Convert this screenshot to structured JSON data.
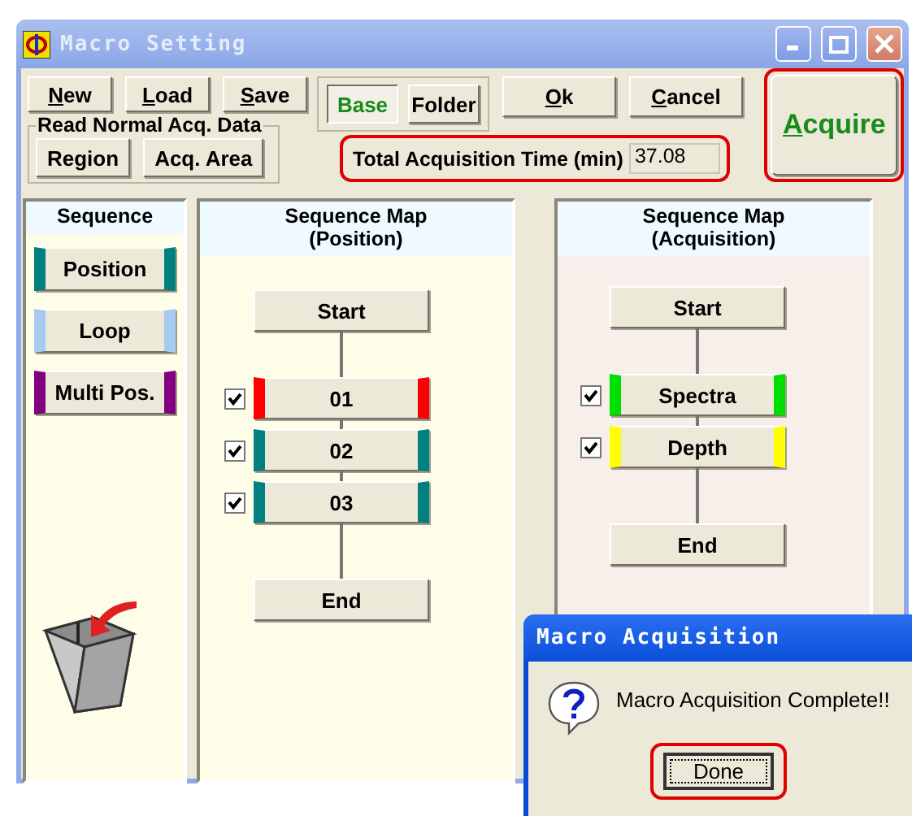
{
  "window": {
    "title": "Macro Setting"
  },
  "file_buttons": [
    {
      "key": "N",
      "rest": "ew"
    },
    {
      "key": "L",
      "rest": "oad"
    },
    {
      "key": "S",
      "rest": "ave"
    }
  ],
  "view_toggle": [
    {
      "label": "Base",
      "selected": true
    },
    {
      "label": "Folder",
      "selected": false
    }
  ],
  "ok_button": {
    "key": "O",
    "rest": "k"
  },
  "cancel_button": {
    "key": "C",
    "rest": "ancel"
  },
  "acquire_button": {
    "key": "A",
    "rest": "cquire",
    "highlighted": true
  },
  "read_group": {
    "legend": "Read Normal Acq. Data",
    "buttons": [
      "Region",
      "Acq. Area"
    ]
  },
  "total_time": {
    "label": "Total Acquisition Time (min)",
    "value": "37.08",
    "highlighted": true
  },
  "sequence": {
    "title": "Sequence",
    "items": [
      {
        "label": "Position",
        "color": "#008080"
      },
      {
        "label": "Loop",
        "color": "#a6caf0"
      },
      {
        "label": "Multi Pos.",
        "color": "#800080"
      }
    ]
  },
  "maps": [
    {
      "title": "Sequence Map\n(Position)",
      "start": "Start",
      "end": "End",
      "steps": [
        {
          "label": "01",
          "checked": true,
          "color": "#ff0000"
        },
        {
          "label": "02",
          "checked": true,
          "color": "#008080"
        },
        {
          "label": "03",
          "checked": true,
          "color": "#008080"
        }
      ]
    },
    {
      "title": "Sequence Map\n(Acquisition)",
      "start": "Start",
      "end": "End",
      "steps": [
        {
          "label": "Spectra",
          "checked": true,
          "color": "#00e000"
        },
        {
          "label": "Depth",
          "checked": true,
          "color": "#ffff00"
        }
      ]
    }
  ],
  "dialog": {
    "title": "Macro Acquisition",
    "message": "Macro Acquisition Complete!!",
    "button": "Done",
    "highlighted": true
  }
}
